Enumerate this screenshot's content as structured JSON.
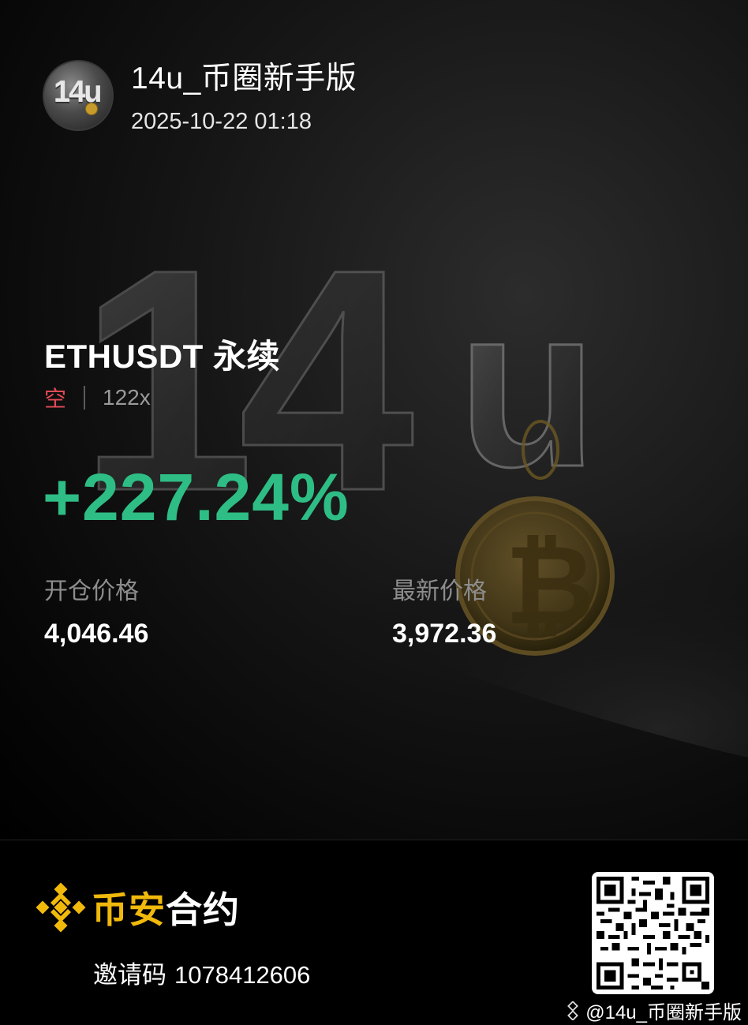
{
  "header": {
    "username": "14u_币圈新手版",
    "timestamp": "2025-10-22 01:18",
    "avatar_text": "14u"
  },
  "background": {
    "big_text_number": "14",
    "big_text_unit": "u"
  },
  "position": {
    "symbol": "ETHUSDT 永续",
    "side": "空",
    "leverage": "122x",
    "pnl_percent": "+227.24%",
    "open_price_label": "开仓价格",
    "open_price": "4,046.46",
    "last_price_label": "最新价格",
    "last_price": "3,972.36"
  },
  "footer": {
    "brand_part1": "币安",
    "brand_part2": "合约",
    "invite_label": "邀请码",
    "invite_code": "1078412606",
    "watermark": "@14u_币圈新手版"
  },
  "colors": {
    "profit": "#2ebd85",
    "short": "#e24a57",
    "brand": "#f0b90b"
  },
  "icons": {
    "brand_logo": "binance-logo-icon",
    "qr": "qr-code-icon",
    "watermark": "binance-square-icon"
  }
}
